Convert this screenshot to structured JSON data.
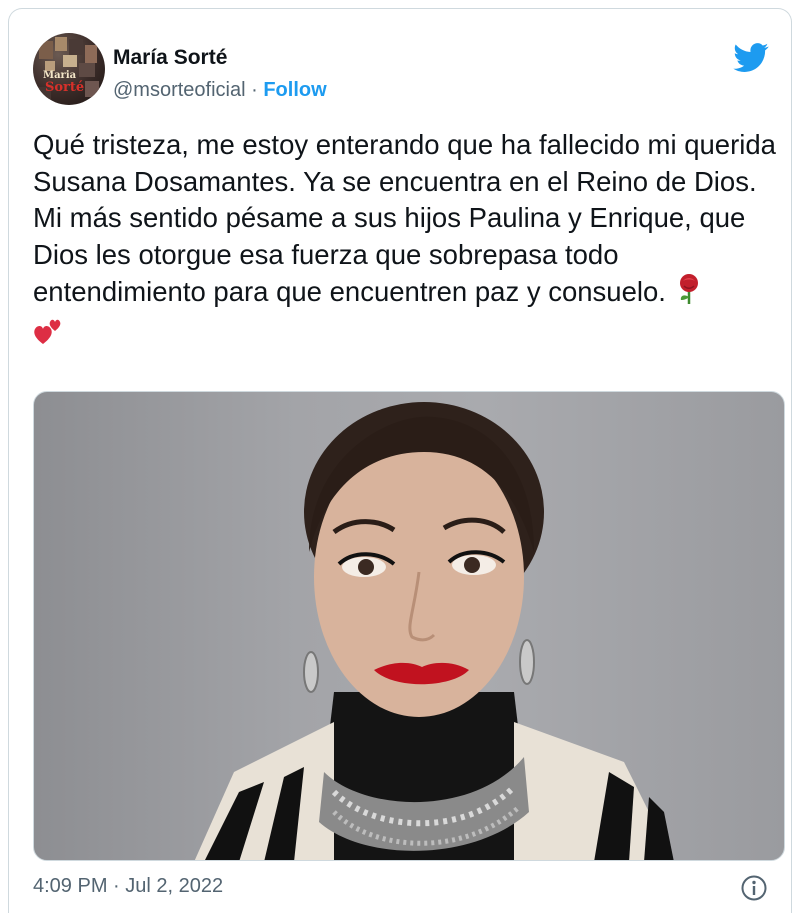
{
  "author": {
    "name": "María Sorté",
    "handle": "@msorteoficial",
    "separator": " · ",
    "follow_label": "Follow",
    "avatar_text_line1": "Maria",
    "avatar_text_line2": "Sorté"
  },
  "tweet": {
    "text": "Qué tristeza, me estoy enterando que ha fallecido mi querida Susana Dosamantes. Ya se encuentra en el Reino de Dios.\nMi más sentido pésame a sus hijos Paulina y Enrique, que Dios les otorgue esa fuerza que sobrepasa todo entendimiento para que encuentren paz y consuelo. ",
    "emojis": [
      "rose-emoji",
      "two-hearts-emoji"
    ],
    "media_icon": "woman-portrait-photo",
    "timestamp": "4:09 PM · Jul 2, 2022"
  },
  "icons": {
    "brand": "twitter-bird-icon",
    "info": "info-icon"
  },
  "colors": {
    "accent": "#1d9bf0",
    "text": "#0f1419",
    "muted": "#536471",
    "border": "#cfd9de"
  }
}
